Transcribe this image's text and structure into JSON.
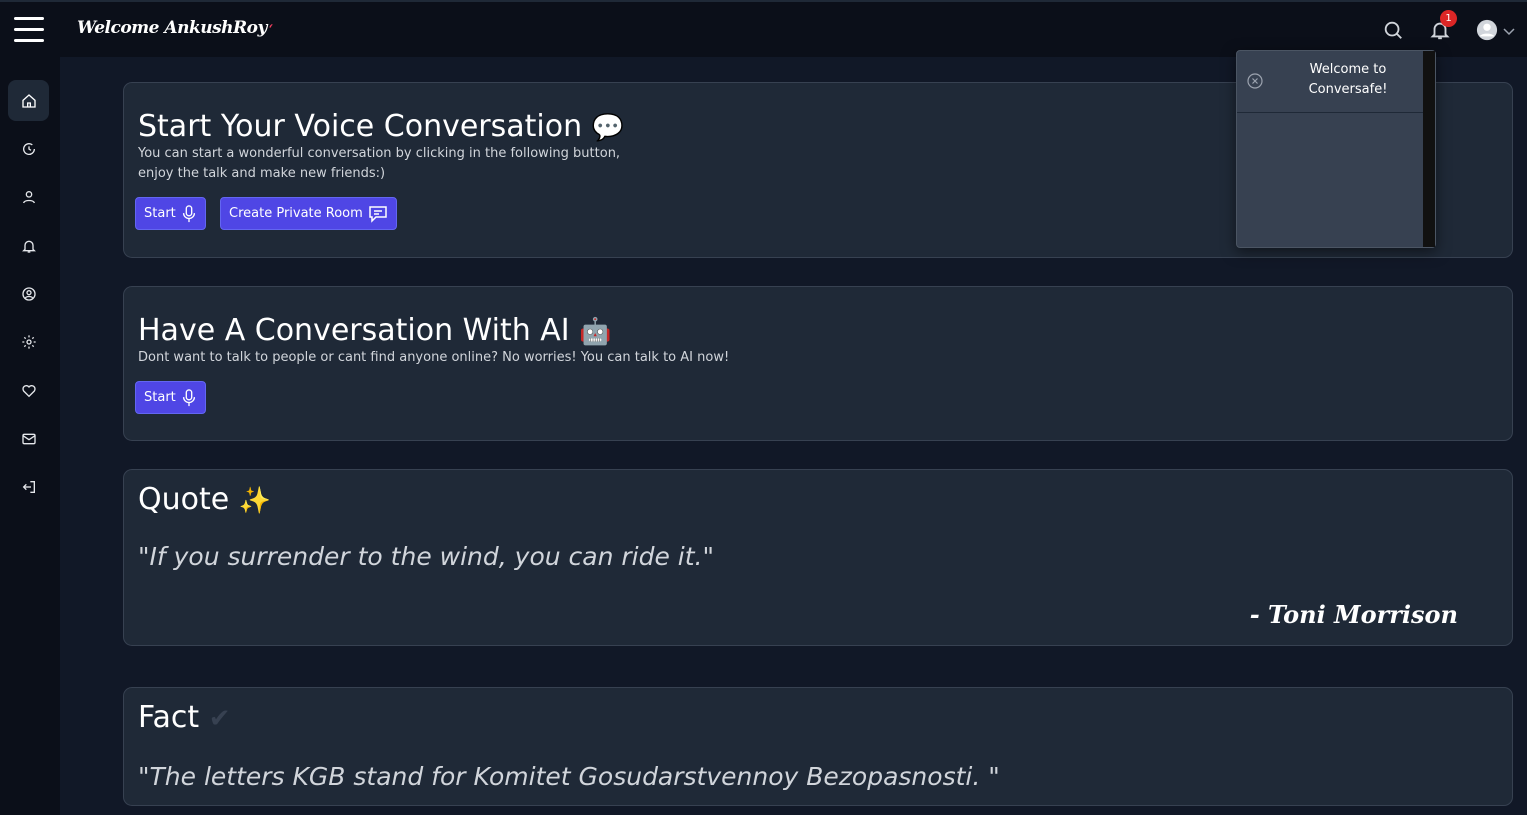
{
  "header": {
    "welcome": "Welcome AnkushRoy",
    "notification_count": "1"
  },
  "sidebar": {
    "items": [
      {
        "name": "home",
        "active": true
      },
      {
        "name": "history"
      },
      {
        "name": "profile"
      },
      {
        "name": "notifications"
      },
      {
        "name": "account"
      },
      {
        "name": "settings"
      },
      {
        "name": "favorites"
      },
      {
        "name": "messages"
      },
      {
        "name": "logout"
      }
    ]
  },
  "voice": {
    "title": "Start Your Voice Conversation",
    "emoji": "💬",
    "desc_line1": "You can start a wonderful conversation by clicking in the following button,",
    "desc_line2": "enjoy the talk and make new friends:)",
    "start_label": "Start",
    "private_room_label": "Create Private Room"
  },
  "ai": {
    "title": "Have A Conversation With AI",
    "emoji": "🤖",
    "desc": "Dont want to talk to people or cant find anyone online? No worries! You can talk to AI now!",
    "start_label": "Start"
  },
  "quote": {
    "title": "Quote",
    "emoji": "✨",
    "text": "\"If you surrender to the wind, you can ride it.\"",
    "author": "- Toni Morrison"
  },
  "fact": {
    "title": "Fact",
    "emoji": "✔",
    "text": "\"The letters KGB stand for Komitet Gosudarstvennoy Bezopasnosti.  \""
  },
  "toast": {
    "message": "Welcome to Conversafe!"
  },
  "colors": {
    "accent": "#4f46e5",
    "card_bg": "#1f2937",
    "page_bg": "#111827",
    "badge": "#dc2626"
  }
}
